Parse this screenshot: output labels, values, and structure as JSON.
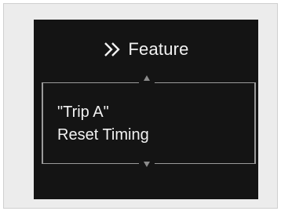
{
  "display": {
    "header": {
      "icon": "double-chevron-right-icon",
      "title": "Feature"
    },
    "message": {
      "line1": "\"Trip A\"",
      "line2": "Reset Timing"
    },
    "scroll": {
      "up_icon": "triangle-up-icon",
      "down_icon": "triangle-down-icon"
    },
    "colors": {
      "screen_bg": "#141414",
      "text": "#f2f2f2",
      "border": "#9a9a9a"
    }
  }
}
